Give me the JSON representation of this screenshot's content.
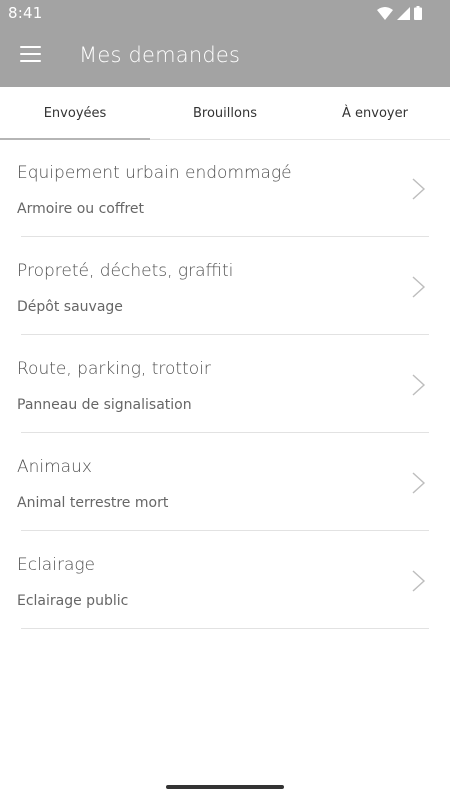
{
  "status": {
    "time": "8:41"
  },
  "app_bar": {
    "title": "Mes demandes"
  },
  "tabs": [
    {
      "label": "Envoyées",
      "active": true
    },
    {
      "label": "Brouillons",
      "active": false
    },
    {
      "label": "À envoyer",
      "active": false
    }
  ],
  "requests": [
    {
      "category": "Equipement urbain endommagé",
      "subcategory": "Armoire ou coffret"
    },
    {
      "category": "Propreté, déchets, graffiti",
      "subcategory": "Dépôt sauvage"
    },
    {
      "category": "Route, parking, trottoir",
      "subcategory": "Panneau de signalisation"
    },
    {
      "category": "Animaux",
      "subcategory": "Animal terrestre mort"
    },
    {
      "category": "Eclairage",
      "subcategory": "Eclairage public"
    }
  ],
  "colors": {
    "app_bar_bg": "#a3a3a3",
    "tab_indicator": "#b5b5b5",
    "divider": "#e2e2e2"
  }
}
